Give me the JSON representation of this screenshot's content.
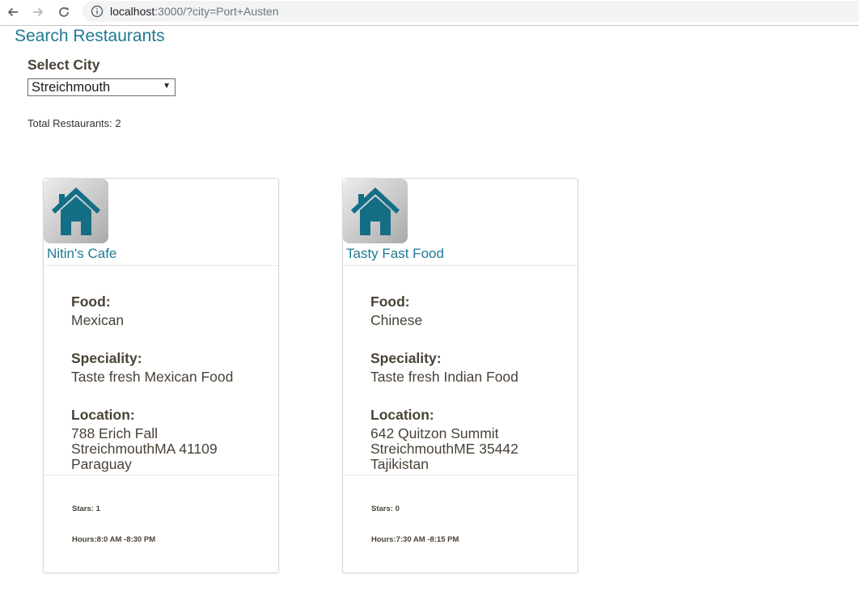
{
  "browser": {
    "url_host": "localhost",
    "url_path": ":3000/?city=Port+Austen"
  },
  "page": {
    "title": "Search Restaurants",
    "select_label": "Select City",
    "selected_city": "Streichmouth",
    "total_label": "Total Restaurants: 2"
  },
  "restaurants": [
    {
      "name": "Nitin's Cafe",
      "food_label": "Food:",
      "food": "Mexican",
      "speciality_label": "Speciality:",
      "speciality": "Taste fresh Mexican Food",
      "location_label": "Location:",
      "address_line1": "788 Erich Fall",
      "address_line2": "StreichmouthMA 41109",
      "address_line3": "Paraguay",
      "stars": "Stars: 1",
      "hours": "Hours:8:0 AM -8:30 PM"
    },
    {
      "name": "Tasty Fast Food",
      "food_label": "Food:",
      "food": "Chinese",
      "speciality_label": "Speciality:",
      "speciality": "Taste fresh Indian Food",
      "location_label": "Location:",
      "address_line1": "642 Quitzon Summit",
      "address_line2": "StreichmouthME 35442",
      "address_line3": "Tajikistan",
      "stars": "Stars: 0",
      "hours": "Hours:7:30 AM -8:15 PM"
    }
  ],
  "icons": {
    "back": "back-arrow-icon",
    "forward": "forward-arrow-icon",
    "reload": "reload-icon",
    "info": "info-icon",
    "restaurant_thumb": "house-icon",
    "select_caret": "caret-down-icon"
  },
  "colors": {
    "title": "#1f7a94",
    "house": "#136e86",
    "text": "#4a4237"
  }
}
